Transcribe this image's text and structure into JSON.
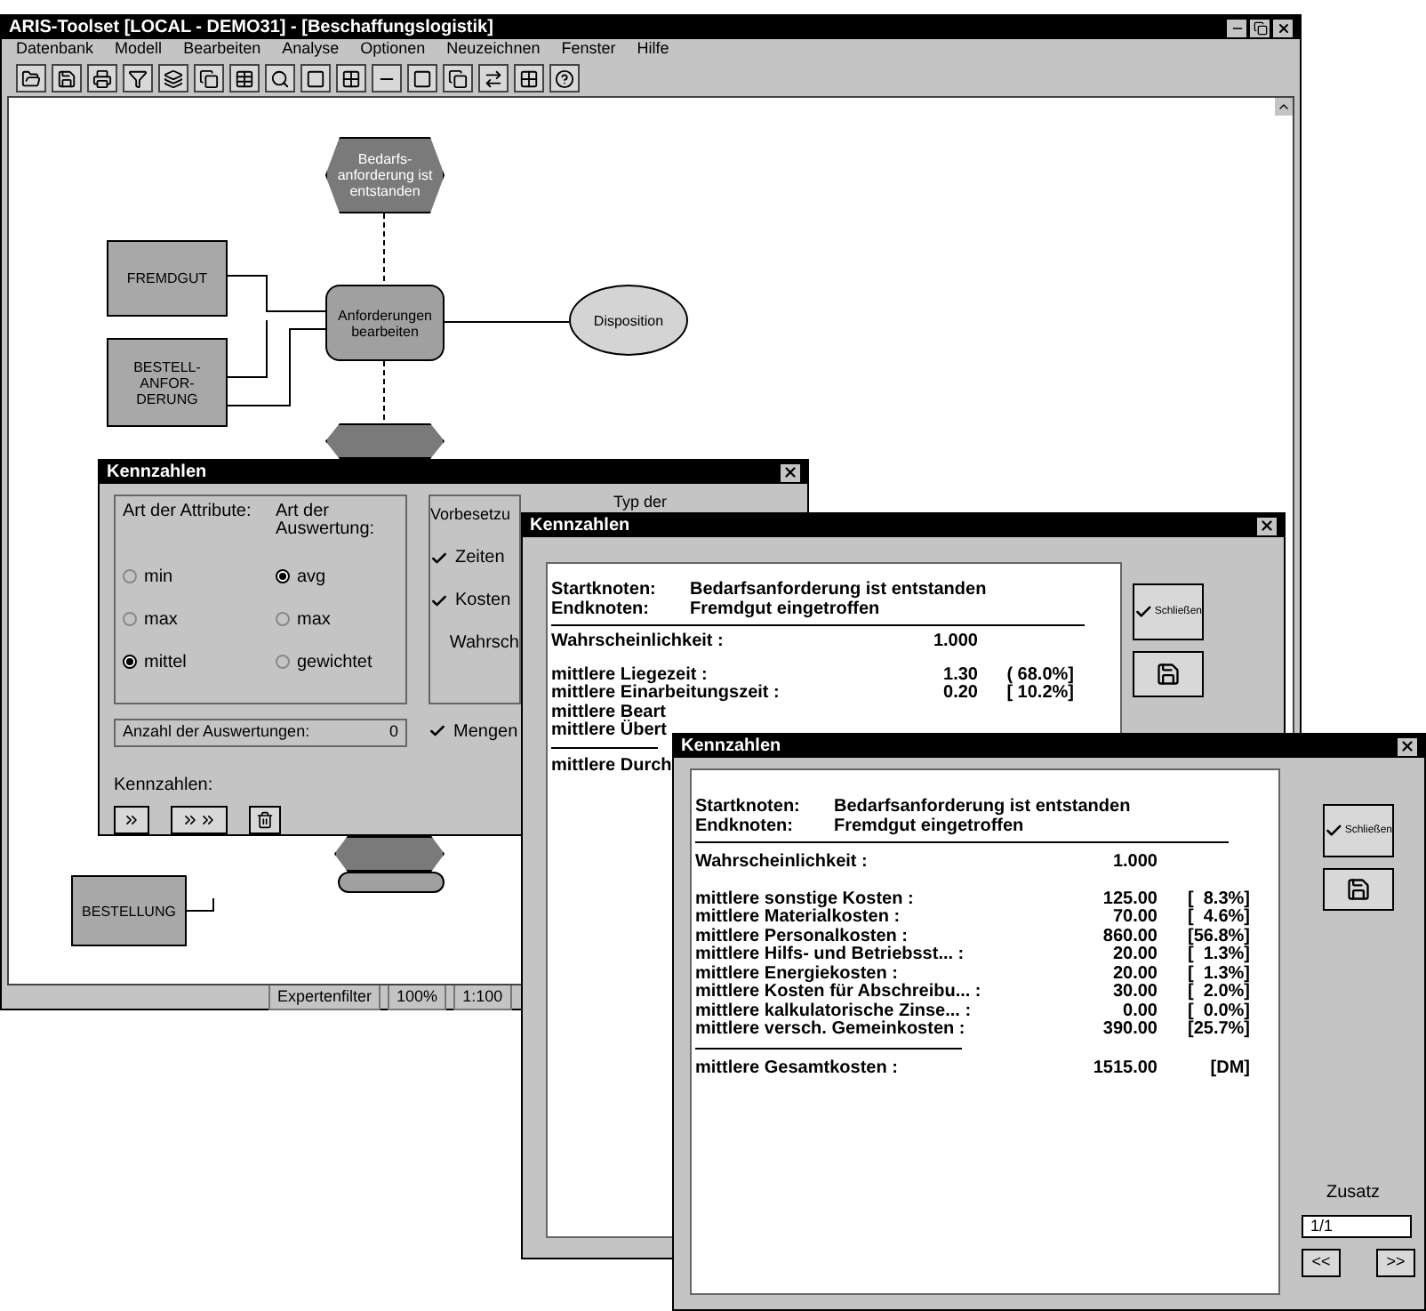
{
  "app": {
    "title": "ARIS-Toolset [LOCAL - DEMO31] - [Beschaffungslogistik]"
  },
  "menu": [
    "Datenbank",
    "Modell",
    "Bearbeiten",
    "Analyse",
    "Optionen",
    "Neuzeichnen",
    "Fenster",
    "Hilfe"
  ],
  "diagram": {
    "nodes": [
      {
        "kind": "event",
        "label": "Bedarfs-anforderung ist entstanden"
      },
      {
        "kind": "object",
        "label": "FREMDGUT"
      },
      {
        "kind": "object",
        "label": "BESTELL-ANFOR-DERUNG"
      },
      {
        "kind": "function",
        "label": "Anforderungen bearbeiten"
      },
      {
        "kind": "unit",
        "label": "Disposition"
      },
      {
        "kind": "event"
      },
      {
        "kind": "event"
      },
      {
        "kind": "function"
      },
      {
        "kind": "object",
        "label": "BESTELLUNG"
      }
    ]
  },
  "status_bar": [
    "Expertenfilter",
    "100%",
    "1:100"
  ],
  "attributes_dialog": {
    "title": "Kennzahlen",
    "attribute_type": {
      "label": "Art der Attribute:",
      "options": [
        {
          "label": "min",
          "selected": false
        },
        {
          "label": "max",
          "selected": false
        },
        {
          "label": "mittel",
          "selected": true
        }
      ]
    },
    "evaluation_type": {
      "label": "Art der Auswertung:",
      "options": [
        {
          "label": "avg",
          "selected": true
        },
        {
          "label": "max",
          "selected": false
        },
        {
          "label": "gewichtet",
          "selected": false
        }
      ]
    },
    "defaults": {
      "label": "Vorbesetzu",
      "options": [
        {
          "label": "Zeiten",
          "checked": true
        },
        {
          "label": "Kosten",
          "checked": true
        },
        {
          "label": "Wahrsch",
          "checked": false
        }
      ]
    },
    "type_label": "Typ der",
    "count_label": "Anzahl der Auswertungen:",
    "count": "0",
    "quantities": {
      "label": "Mengen",
      "checked": true
    },
    "figures_label": "Kennzahlen:"
  },
  "time_dialog": {
    "title": "Kennzahlen",
    "start_label": "Startknoten:",
    "start": "Bedarfsanforderung ist entstanden",
    "end_label": "Endknoten:",
    "end": "Fremdgut eingetroffen",
    "probability_label": "Wahrscheinlichkeit :",
    "probability": "1.000",
    "rows": [
      {
        "label": "mittlere Liegezeit :",
        "value": "1.30",
        "share": "( 68.0%]"
      },
      {
        "label": "mittlere Einarbeitungszeit :",
        "value": "0.20",
        "share": "[ 10.2%]"
      },
      {
        "label": "mittlere Beart"
      },
      {
        "label": "mittlere Übert"
      }
    ],
    "total_label": "mittlere Durch",
    "close": "Schließen"
  },
  "cost_dialog": {
    "title": "Kennzahlen",
    "start_label": "Startknoten:",
    "start": "Bedarfsanforderung ist entstanden",
    "end_label": "Endknoten:",
    "end": "Fremdgut eingetroffen",
    "probability_label": "Wahrscheinlichkeit :",
    "probability": "1.000",
    "rows": [
      {
        "label": "mittlere sonstige Kosten :",
        "value": "125.00",
        "share": "[  8.3%]"
      },
      {
        "label": "mittlere Materialkosten :",
        "value": "70.00",
        "share": "[  4.6%]"
      },
      {
        "label": "mittlere Personalkosten :",
        "value": "860.00",
        "share": "[56.8%]"
      },
      {
        "label": "mittlere Hilfs- und Betriebsst... :",
        "value": "20.00",
        "share": "[  1.3%]"
      },
      {
        "label": "mittlere Energiekosten :",
        "value": "20.00",
        "share": "[  1.3%]"
      },
      {
        "label": "mittlere Kosten für Abschreibu... :",
        "value": "30.00",
        "share": "[  2.0%]"
      },
      {
        "label": "mittlere kalkulatorische Zinse... :",
        "value": "0.00",
        "share": "[  0.0%]"
      },
      {
        "label": "mittlere versch. Gemeinkosten :",
        "value": "390.00",
        "share": "[25.7%]"
      }
    ],
    "total_label": "mittlere Gesamtkosten :",
    "total": "1515.00",
    "unit": "[DM]",
    "close": "Schließen",
    "extra": {
      "label": "Zusatz",
      "checked": false
    },
    "page": "1/1",
    "prev": "<<",
    "next": ">>"
  }
}
